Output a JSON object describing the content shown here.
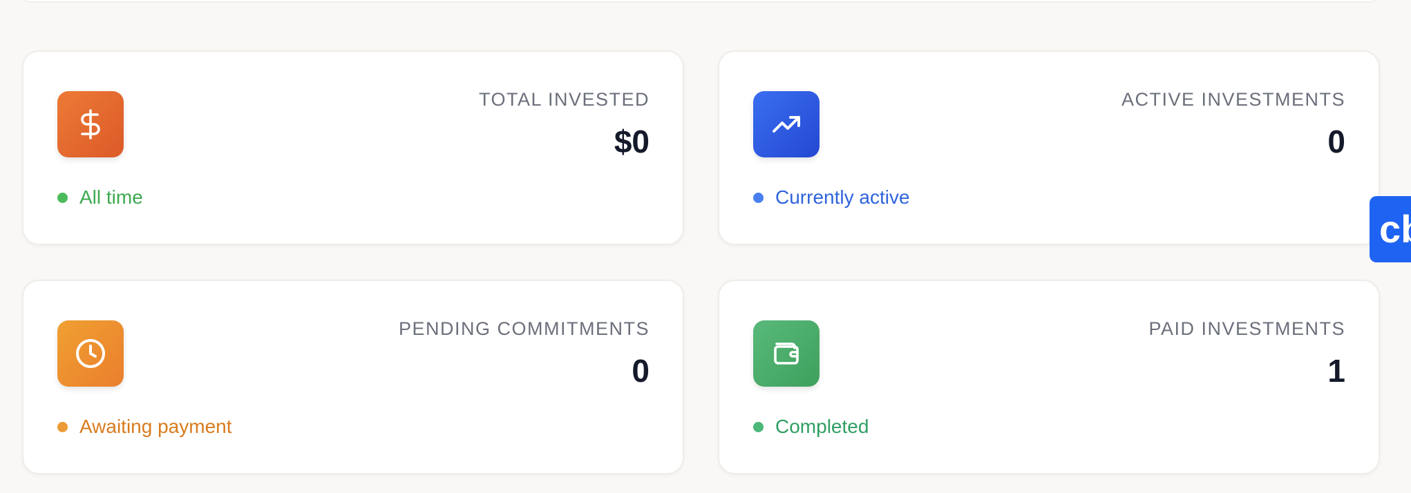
{
  "cards": [
    {
      "label": "TOTAL INVESTED",
      "value": "$0",
      "status": "All time",
      "icon": "dollar-icon",
      "status_color": "#3daa4f",
      "icon_gradient": [
        "#ec7a36",
        "#dc5a28"
      ]
    },
    {
      "label": "ACTIVE INVESTMENTS",
      "value": "0",
      "status": "Currently active",
      "icon": "trending-up-icon",
      "status_color": "#2f63dc",
      "icon_gradient": [
        "#3a6ef0",
        "#2448d2"
      ]
    },
    {
      "label": "PENDING COMMITMENTS",
      "value": "0",
      "status": "Awaiting payment",
      "icon": "clock-icon",
      "status_color": "#d87b1e",
      "icon_gradient": [
        "#f0a032",
        "#ea7e2d"
      ]
    },
    {
      "label": "PAID INVESTMENTS",
      "value": "1",
      "status": "Completed",
      "icon": "wallet-icon",
      "status_color": "#2f9e63",
      "icon_gradient": [
        "#58b97a",
        "#3fa05d"
      ]
    }
  ],
  "chat_widget": {
    "label": "cb",
    "color": "#1f63f2"
  }
}
